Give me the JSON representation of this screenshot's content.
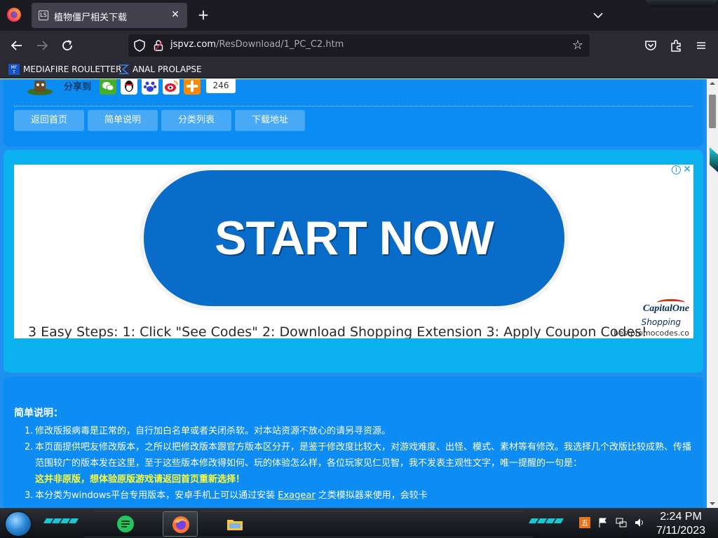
{
  "browser": {
    "tab": {
      "favicon_text": "LS",
      "title": "植物僵尸相关下载"
    },
    "url": {
      "domain": "jspvz.com",
      "path": "/ResDownload/1_PC_C2.htm"
    },
    "bookmarks": [
      {
        "icon": "mediafire-icon",
        "label": "MEDIAFIRE ROULETTER"
      },
      {
        "icon": "sigma-icon",
        "label": "ANAL PROLAPSE"
      }
    ]
  },
  "page": {
    "share": {
      "label": "分享到",
      "count": "246"
    },
    "nav_tabs": [
      "返回首页",
      "简单说明",
      "分类列表",
      "下载地址"
    ],
    "ad": {
      "cta": "START NOW",
      "steps": "3 Easy Steps: 1: Click \"See Codes\" 2: Download Shopping Extension 3: Apply Coupon Codes!",
      "brand": "CapitalOne",
      "brand_sub": "Shopping",
      "domain": "bestpromocodes.co"
    },
    "description": {
      "title": "简单说明：",
      "item1": "修改版报病毒是正常的，自行加白名单或者关闭杀软。对本站资源不放心的请另寻资源。",
      "item2": "本页面提供吧友修改版本，之所以把修改版本跟官方版本区分开，是鉴于修改度比较大，对游戏难度、出怪、模式、素材等有修改。我选择几个改版比较成熟、传播范围较广的版本发在这里，至于这些版本修改得如何、玩的体验怎么样，各位玩家见仁见智，我不发表主观性文字，唯一提醒的一句是：",
      "warning": "这并非原版，想体验原版游戏请返回首页重新选择！",
      "item3_before": "本分类为windows平台专用版本，安卓手机上可以通过安装 ",
      "item3_link": "Exagear",
      "item3_after": " 之类模拟器来使用，会较卡"
    }
  },
  "taskbar": {
    "time": "2:24 PM",
    "date": "7/11/2023"
  },
  "colors": {
    "page_bg": "#1e90f0",
    "warning": "#ffff33",
    "ad_button": "#0a6cc9",
    "nav_tab": "#48aaf6"
  }
}
